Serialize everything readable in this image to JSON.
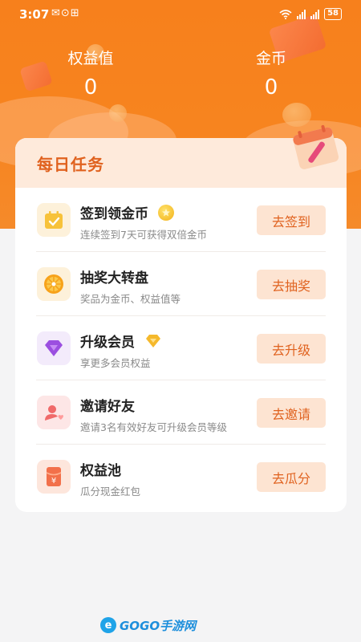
{
  "status_bar": {
    "time": "3:07",
    "left_icons": "✉⊙⊞",
    "battery": "58"
  },
  "stats": {
    "equity": {
      "label": "权益值",
      "value": "0"
    },
    "coins": {
      "label": "金币",
      "value": "0"
    }
  },
  "daily_tasks": {
    "title": "每日任务",
    "tasks": [
      {
        "title": "签到领金币",
        "desc": "连续签到7天可获得双倍金币",
        "button": "去签到",
        "icon": "calendar-check-icon"
      },
      {
        "title": "抽奖大转盘",
        "desc": "奖品为金币、权益值等",
        "button": "去抽奖",
        "icon": "lucky-wheel-icon"
      },
      {
        "title": "升级会员",
        "desc": "享更多会员权益",
        "button": "去升级",
        "icon": "diamond-icon"
      },
      {
        "title": "邀请好友",
        "desc": "邀请3名有效好友可升级会员等级",
        "button": "去邀请",
        "icon": "invite-user-icon"
      },
      {
        "title": "权益池",
        "desc": "瓜分现金红包",
        "button": "去瓜分",
        "icon": "red-envelope-icon"
      }
    ]
  },
  "watermark": {
    "brand": "GOGO手游网"
  },
  "colors": {
    "hero_orange": "#f7801c",
    "accent": "#e0621f",
    "button_bg": "#fde4d2",
    "header_bg": "#feeadb"
  }
}
